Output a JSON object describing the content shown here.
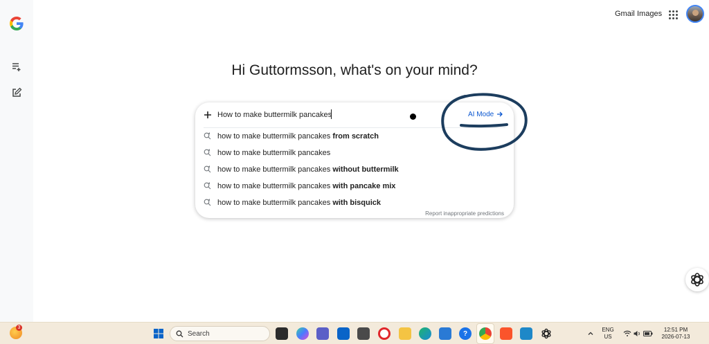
{
  "header": {
    "gmail_label": "Gmail",
    "images_label": "Images"
  },
  "greeting": "Hi Guttormsson, what's on your mind?",
  "search": {
    "query": "How to make buttermilk pancakes",
    "ai_mode_label": "AI Mode",
    "suggestions": [
      {
        "base": "how to make buttermilk pancakes ",
        "bold": "from scratch"
      },
      {
        "base": "how to make buttermilk pancakes",
        "bold": ""
      },
      {
        "base": "how to make buttermilk pancakes ",
        "bold": "without buttermilk"
      },
      {
        "base": "how to make buttermilk pancakes ",
        "bold": "with pancake mix"
      },
      {
        "base": "how to make buttermilk pancakes ",
        "bold": "with bisquick"
      }
    ],
    "report_label": "Report inappropriate predictions"
  },
  "taskbar": {
    "search_placeholder": "Search",
    "weather_badge": "3",
    "lang_line1": "ENG",
    "lang_line2": "US",
    "time": "12:51 PM",
    "date": "2026-07-13"
  },
  "colors": {
    "accent_blue": "#0b57d0",
    "annotation_ink": "#1c3d5e",
    "taskbar_bg": "#f3eadb",
    "sidebar_bg": "#f8f9fa"
  },
  "icons": {
    "logo": "google-g-logo",
    "sidebar_1": "playlist-add-icon",
    "sidebar_2": "edit-note-icon",
    "apps": "apps-grid-icon",
    "plus": "plus-icon",
    "ai_arrow": "arrow-right-icon",
    "suggestion": "search-trend-icon",
    "assistant": "gemini-icon"
  }
}
